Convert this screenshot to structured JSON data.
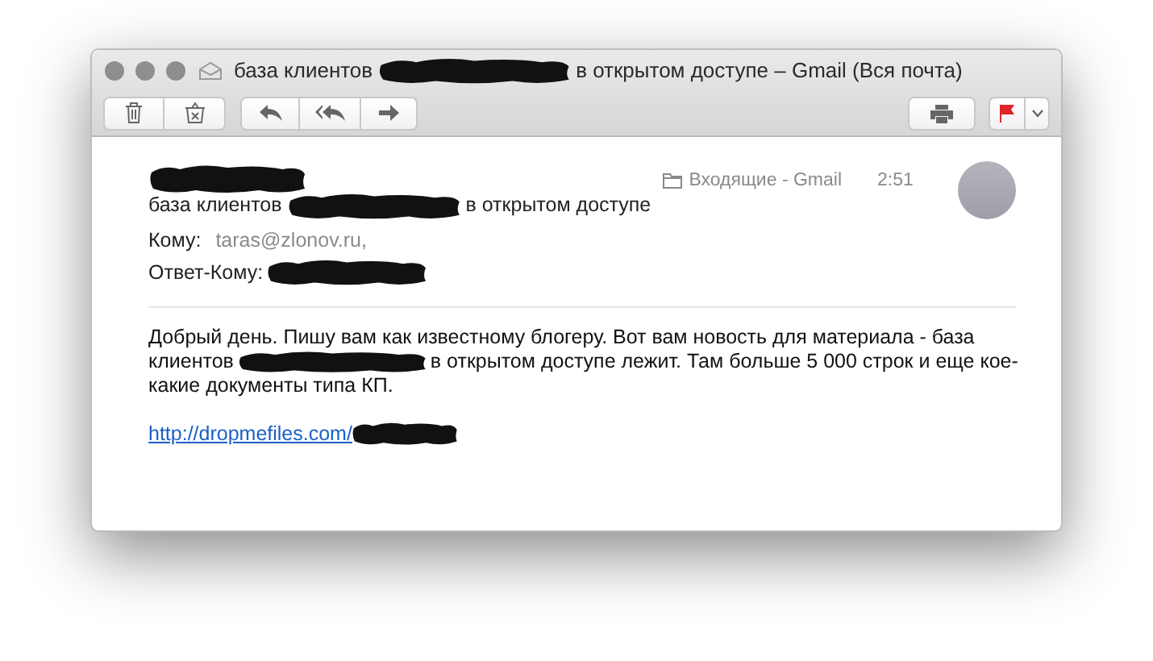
{
  "window": {
    "title_parts": [
      "база клиентов",
      "в открытом доступе – Gmail (Вся почта)"
    ]
  },
  "message": {
    "mailbox": "Входящие - Gmail",
    "time": "2:51",
    "subject_parts": [
      "база клиентов",
      "в открытом доступе"
    ],
    "to_label": "Кому:",
    "to_value": "taras@zlonov.ru,",
    "reply_to_label": "Ответ-Кому:",
    "body_lines": [
      [
        "Добрый день. Пишу вам как известному блогеру. Вот вам новость для материала - база"
      ],
      [
        "клиентов",
        "в открытом доступе лежит. Там больше 5 000 строк и еще кое-"
      ],
      [
        "какие документы типа КП."
      ]
    ],
    "link": "http://dropmefiles.com/"
  }
}
